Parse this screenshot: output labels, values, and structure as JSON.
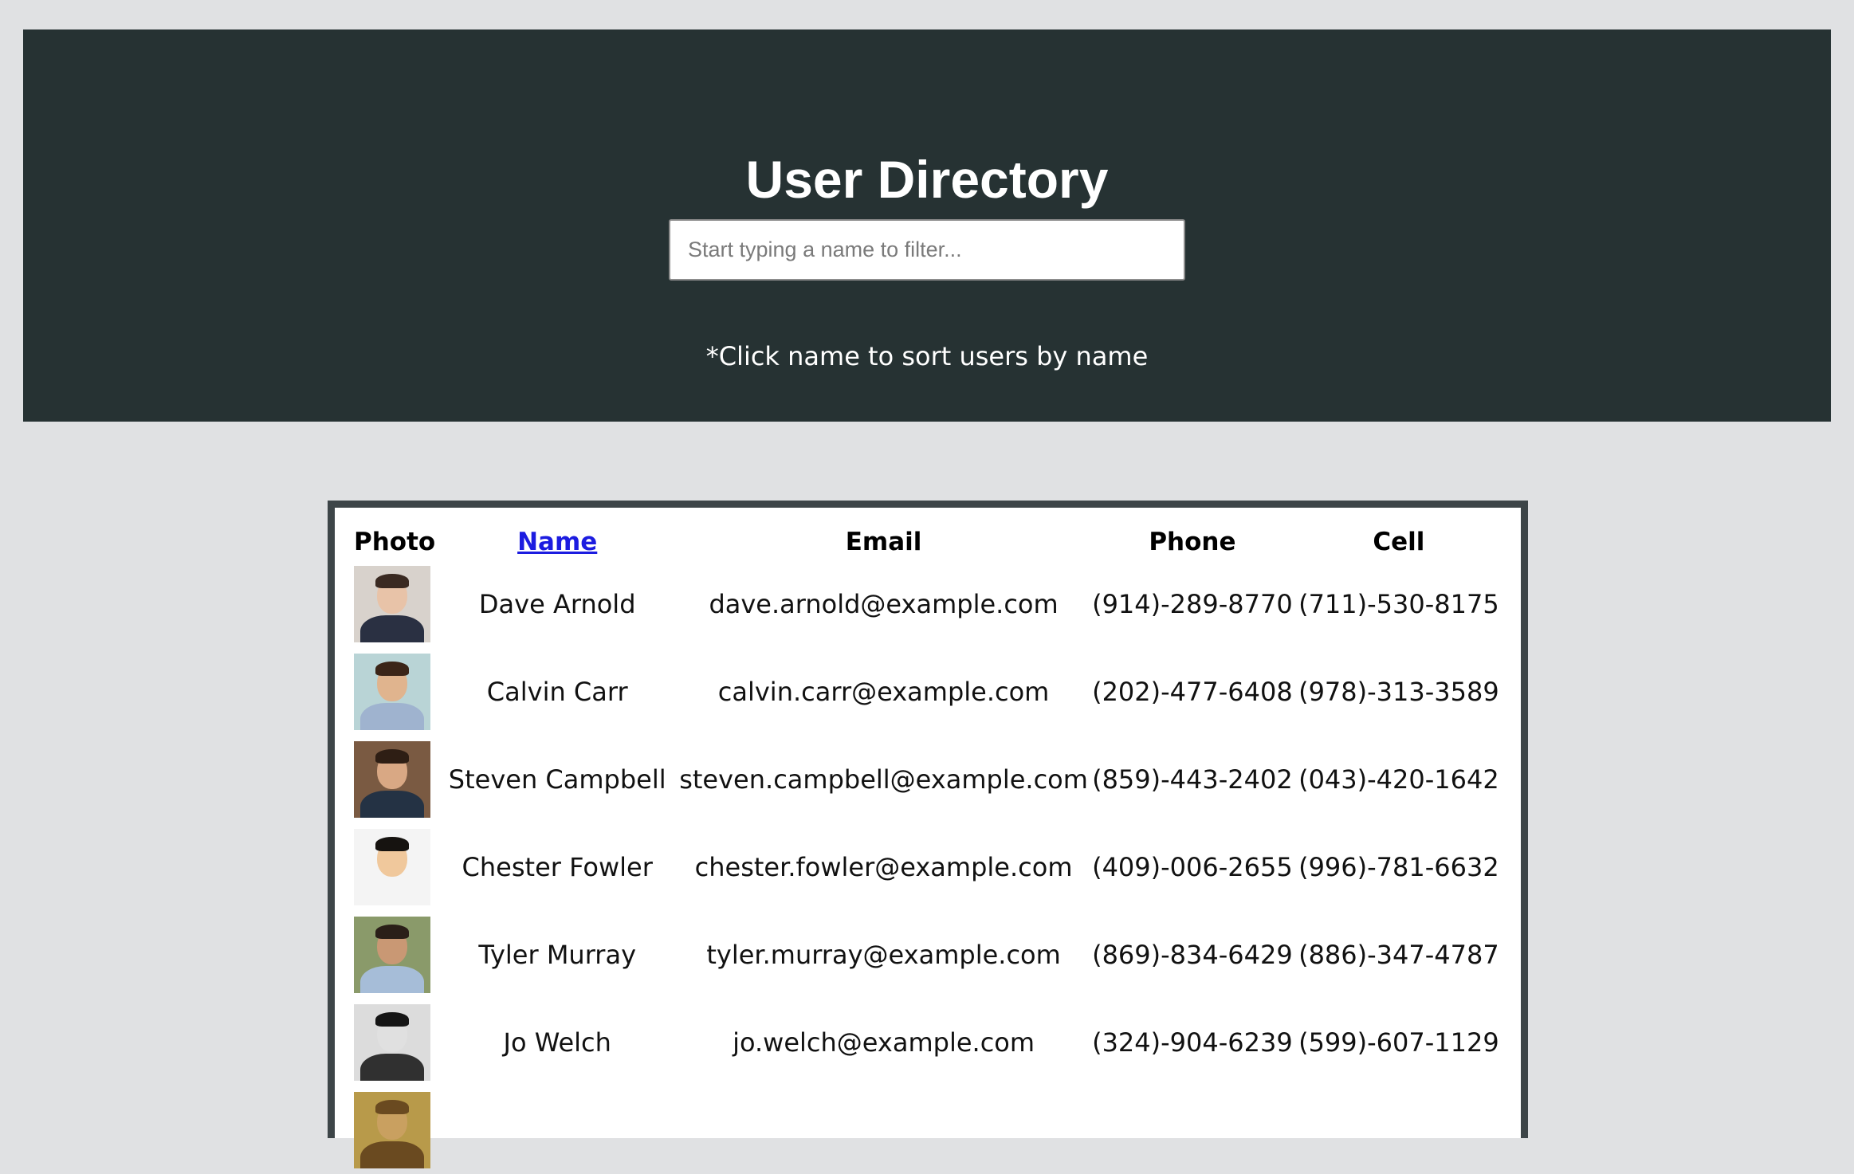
{
  "header": {
    "title": "User Directory",
    "search_placeholder": "Start typing a name to filter...",
    "hint": "*Click name to sort users by name"
  },
  "table": {
    "columns": [
      "Photo",
      "Name",
      "Email",
      "Phone",
      "Cell"
    ],
    "rows": [
      {
        "name": "Dave Arnold",
        "email": "dave.arnold@example.com",
        "phone": "(914)-289-8770",
        "cell": "(711)-530-8175",
        "photo": {
          "bg": "#d8d2cc",
          "skin": "#e8c3a8",
          "hair": "#3a2a22",
          "shirt": "#2a3042"
        }
      },
      {
        "name": "Calvin Carr",
        "email": "calvin.carr@example.com",
        "phone": "(202)-477-6408",
        "cell": "(978)-313-3589",
        "photo": {
          "bg": "#b9d4d6",
          "skin": "#e0b48e",
          "hair": "#3b2518",
          "shirt": "#9fb3cf"
        }
      },
      {
        "name": "Steven Campbell",
        "email": "steven.campbell@example.com",
        "phone": "(859)-443-2402",
        "cell": "(043)-420-1642",
        "photo": {
          "bg": "#7a5a42",
          "skin": "#d9a884",
          "hair": "#2e1e14",
          "shirt": "#243244"
        }
      },
      {
        "name": "Chester Fowler",
        "email": "chester.fowler@example.com",
        "phone": "(409)-006-2655",
        "cell": "(996)-781-6632",
        "photo": {
          "bg": "#f4f4f4",
          "skin": "#f0c89c",
          "hair": "#161310",
          "shirt": "#f4f4f4"
        }
      },
      {
        "name": "Tyler Murray",
        "email": "tyler.murray@example.com",
        "phone": "(869)-834-6429",
        "cell": "(886)-347-4787",
        "photo": {
          "bg": "#8a9a6a",
          "skin": "#c99874",
          "hair": "#2a1f18",
          "shirt": "#a6bdd8"
        }
      },
      {
        "name": "Jo Welch",
        "email": "jo.welch@example.com",
        "phone": "(324)-904-6239",
        "cell": "(599)-607-1129",
        "photo": {
          "bg": "#dcdcdc",
          "skin": "#e0e0e0",
          "hair": "#151515",
          "shirt": "#303030"
        }
      },
      {
        "name": "",
        "email": "",
        "phone": "",
        "cell": "",
        "photo": {
          "bg": "#b89a4a",
          "skin": "#c9a060",
          "hair": "#6a4a20",
          "shirt": "#6a4a20"
        }
      }
    ]
  }
}
